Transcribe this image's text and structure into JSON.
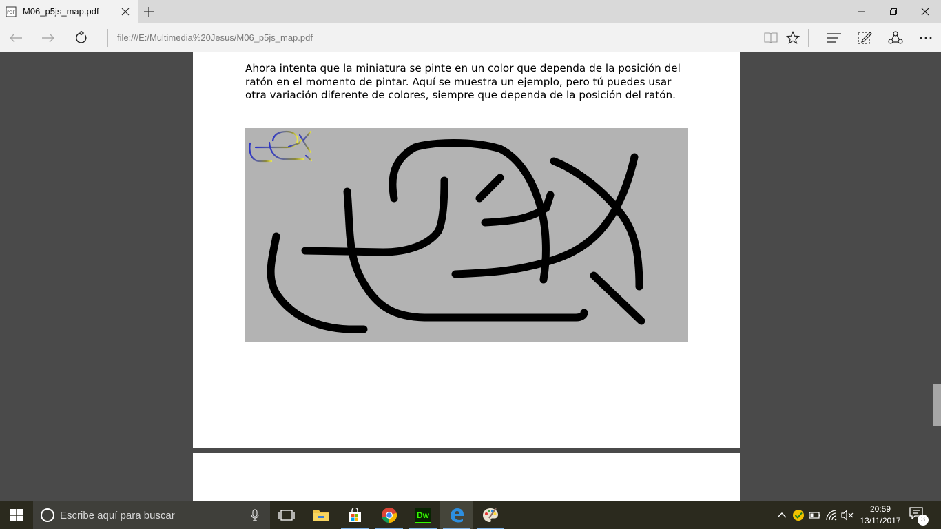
{
  "tab": {
    "title": "M06_p5js_map.pdf"
  },
  "address_bar": {
    "url": "file:///E:/Multimedia%20Jesus/M06_p5js_map.pdf"
  },
  "pdf": {
    "paragraph": "Ahora intenta que la miniatura se pinte en un color que dependa de la posición del ratón en el momento de pintar. Aquí se muestra un ejemplo, pero tú puedes usar otra variación diferente de colores, siempre que dependa de la posición del ratón."
  },
  "taskbar": {
    "search_placeholder": "Escribe aquí para buscar",
    "dw_label": "Dw",
    "time": "20:59",
    "date": "13/11/2017",
    "notification_count": "3"
  },
  "colors": {
    "tab_strip": "#d9d9d9",
    "active_tab": "#f2f2f2",
    "viewer_bg": "#4a4a4a",
    "figure_bg": "#b3b3b3",
    "taskbar": "#2b2a1e",
    "dreamweaver": "#35fa00"
  },
  "icons": {
    "tab": [
      "pdf-icon",
      "close-icon",
      "plus-icon"
    ],
    "window": [
      "minimize-icon",
      "restore-icon",
      "close-icon"
    ],
    "navigation": [
      "back-arrow-icon",
      "forward-arrow-icon",
      "refresh-icon"
    ],
    "toolbar": [
      "reading-view-icon",
      "star-icon",
      "hub-icon",
      "web-note-icon",
      "share-icon",
      "more-icon"
    ],
    "taskbar": [
      "windows-logo-icon",
      "cortana-icon",
      "microphone-icon",
      "task-view-icon",
      "file-explorer-icon",
      "store-icon",
      "chrome-icon",
      "dreamweaver-icon",
      "edge-icon",
      "paint-icon"
    ],
    "tray": [
      "chevron-up-icon",
      "security-icon",
      "battery-icon",
      "wifi-icon",
      "volume-muted-icon",
      "notification-icon"
    ]
  }
}
